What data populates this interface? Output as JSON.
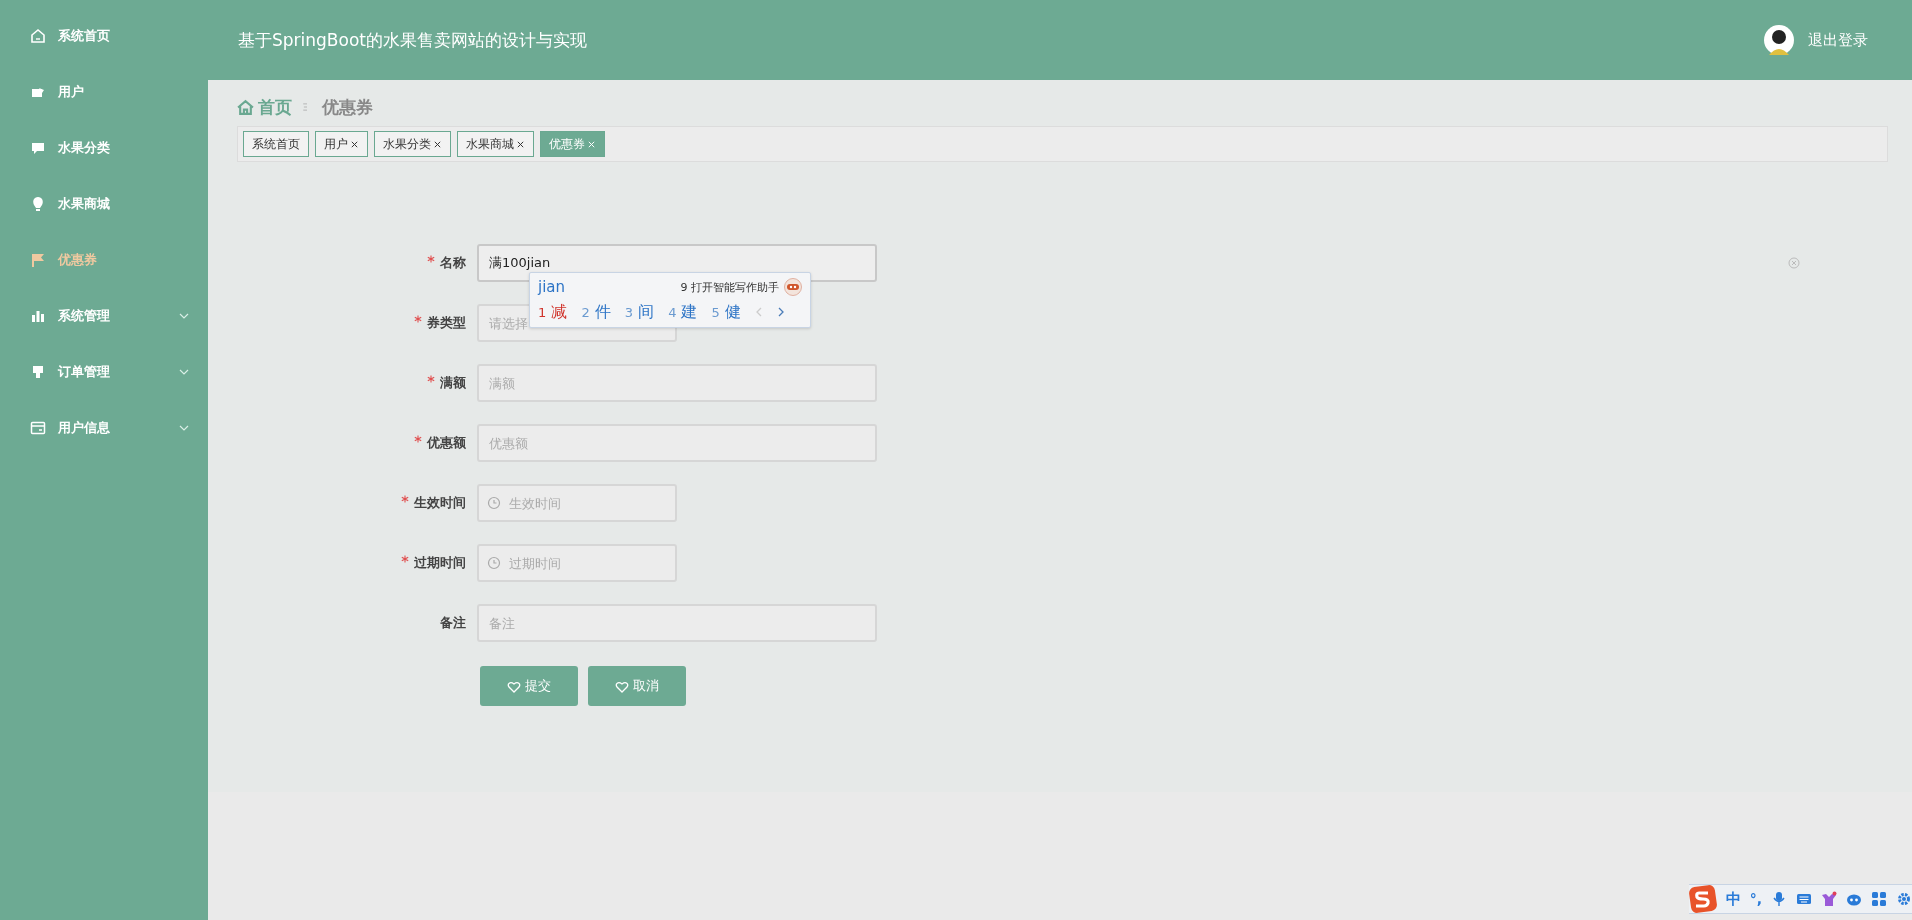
{
  "sidebar": {
    "items": [
      {
        "label": "系统首页",
        "kind": "link",
        "selected": false
      },
      {
        "label": "用户",
        "kind": "link",
        "selected": false
      },
      {
        "label": "水果分类",
        "kind": "link",
        "selected": false
      },
      {
        "label": "水果商城",
        "kind": "link",
        "selected": false
      },
      {
        "label": "优惠券",
        "kind": "link",
        "selected": true
      },
      {
        "label": "系统管理",
        "kind": "submenu",
        "selected": false
      },
      {
        "label": "订单管理",
        "kind": "submenu",
        "selected": false
      },
      {
        "label": "用户信息",
        "kind": "submenu",
        "selected": false
      }
    ]
  },
  "header": {
    "title": "基于SpringBoot的水果售卖网站的设计与实现",
    "logout": "退出登录"
  },
  "breadcrumb": {
    "home": "首页",
    "current": "优惠券"
  },
  "tabs": [
    {
      "label": "系统首页",
      "closable": false,
      "selected": false
    },
    {
      "label": "用户",
      "closable": true,
      "selected": false
    },
    {
      "label": "水果分类",
      "closable": true,
      "selected": false
    },
    {
      "label": "水果商城",
      "closable": true,
      "selected": false
    },
    {
      "label": "优惠券",
      "closable": true,
      "selected": true
    }
  ],
  "form": {
    "fields": [
      {
        "label": "名称",
        "required": true,
        "kind": "text",
        "value": "满100jian",
        "focused": true
      },
      {
        "label": "券类型",
        "required": true,
        "kind": "select",
        "placeholder": "请选择",
        "focused": false
      },
      {
        "label": "满额",
        "required": true,
        "kind": "text",
        "placeholder": "满额",
        "focused": false
      },
      {
        "label": "优惠额",
        "required": true,
        "kind": "text",
        "placeholder": "优惠额",
        "focused": false
      },
      {
        "label": "生效时间",
        "required": true,
        "kind": "date",
        "placeholder": "生效时间",
        "focused": false
      },
      {
        "label": "过期时间",
        "required": true,
        "kind": "date",
        "placeholder": "过期时间",
        "focused": false
      },
      {
        "label": "备注",
        "required": false,
        "kind": "text",
        "placeholder": "备注",
        "focused": false
      }
    ],
    "buttons": [
      "提交",
      "取消"
    ]
  },
  "ime_popup": {
    "composition": "jian",
    "assistant": "9 打开智能写作助手",
    "candidates": [
      {
        "index": "1",
        "text": "减",
        "selected": true
      },
      {
        "index": "2",
        "text": "件",
        "selected": false
      },
      {
        "index": "3",
        "text": "间",
        "selected": false
      },
      {
        "index": "4",
        "text": "建",
        "selected": false
      },
      {
        "index": "5",
        "text": "健",
        "selected": false
      }
    ]
  },
  "ime_toolbar": {
    "mode": "中",
    "punctuation": "°,"
  }
}
